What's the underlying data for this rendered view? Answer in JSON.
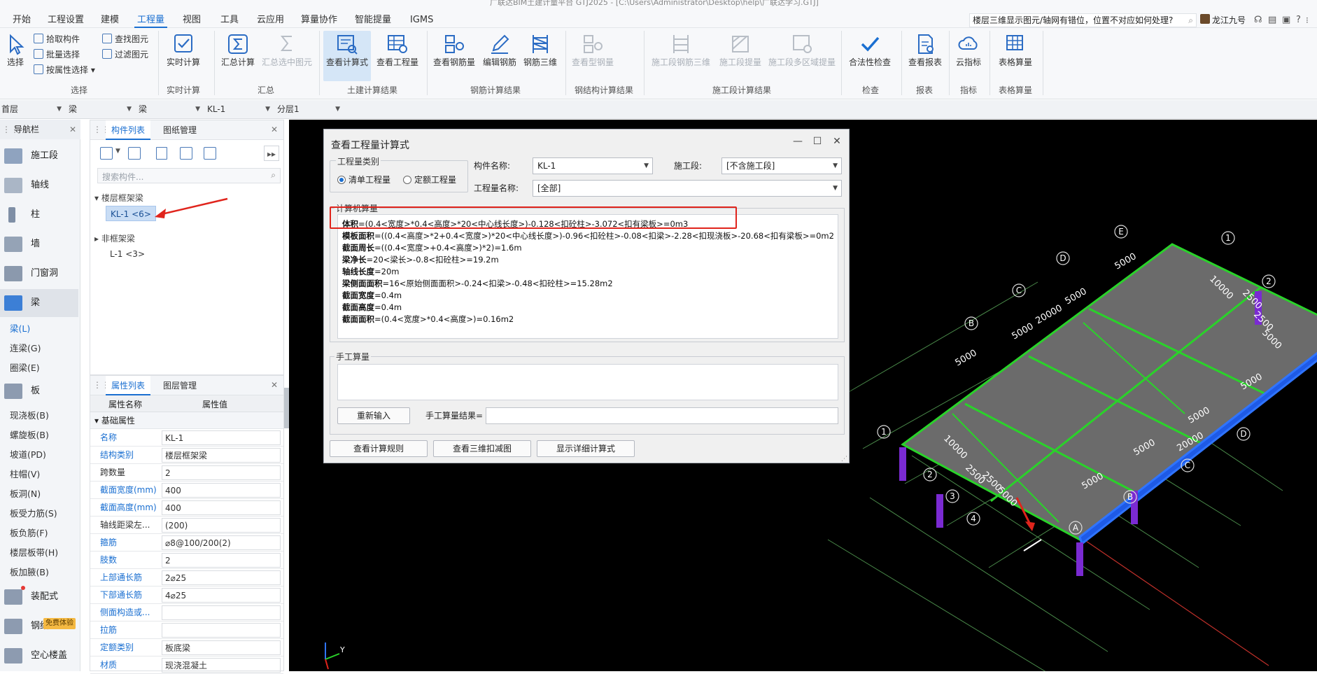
{
  "titlebar": {
    "left": "广联达BIM土建计量平台 GTJ2025 - [C:\\Users\\Administrator\\Desktop\\help\\广联达学习.GTJ]"
  },
  "menu": {
    "items": [
      "开始",
      "工程设置",
      "建模",
      "工程量",
      "视图",
      "工具",
      "云应用",
      "算量协作",
      "智能提量",
      "IGMS"
    ],
    "active_index": 3,
    "search_text": "楼层三维显示图元/轴网有错位，位置不对应如何处理?",
    "user": "龙江九号",
    "help": "?"
  },
  "ribbon": {
    "select": {
      "big": "选择",
      "s1": "拾取构件",
      "s2": "批量选择",
      "s3": "按属性选择",
      "s4": "查找图元",
      "s5": "过滤图元",
      "group": "选择"
    },
    "realtime": {
      "big": "实时计算",
      "group": "实时计算"
    },
    "summary": {
      "b1": "汇总计算",
      "b2": "汇总选中图元",
      "group": "汇总"
    },
    "civil": {
      "b1": "查看计算式",
      "b2": "查看工程量",
      "group": "土建计算结果"
    },
    "rebar": {
      "b1": "查看钢筋量",
      "b2": "编辑钢筋",
      "b3": "钢筋三维",
      "group": "钢筋计算结果"
    },
    "steel": {
      "b1": "查看型钢量",
      "group": "钢结构计算结果"
    },
    "stage": {
      "b1": "施工段钢筋三维",
      "b2": "施工段提量",
      "b3": "施工段多区域提量",
      "group": "施工段计算结果"
    },
    "check": {
      "b1": "合法性检查",
      "group": "检查"
    },
    "report": {
      "b1": "查看报表",
      "group": "报表"
    },
    "index": {
      "b1": "云指标",
      "group": "指标"
    },
    "table": {
      "b1": "表格算量",
      "group": "表格算量"
    }
  },
  "filterbar": {
    "floor": "首层",
    "type1": "梁",
    "type2": "梁",
    "comp": "KL-1",
    "layer": "分层1"
  },
  "nav": {
    "title": "导航栏",
    "items": [
      {
        "label": "施工段",
        "icon": "stage-icon"
      },
      {
        "label": "轴线",
        "icon": "axis-icon"
      },
      {
        "label": "柱",
        "icon": "column-icon"
      },
      {
        "label": "墙",
        "icon": "wall-icon"
      },
      {
        "label": "门窗洞",
        "icon": "door-window-icon"
      },
      {
        "label": "梁",
        "icon": "beam-icon"
      }
    ],
    "beam_subs": [
      "梁(L)",
      "连梁(G)",
      "圈梁(E)"
    ],
    "slab": "板",
    "slab_subs": [
      "现浇板(B)",
      "螺旋板(B)",
      "坡道(PD)",
      "柱帽(V)",
      "板洞(N)",
      "板受力筋(S)",
      "板负筋(F)",
      "楼层板带(H)",
      "板加腋(B)"
    ],
    "prefab": "装配式",
    "steel": "钢结构",
    "hollow": "空心楼盖",
    "trial_badge": "免费体验"
  },
  "complist": {
    "tabs": [
      "构件列表",
      "图纸管理"
    ],
    "search_placeholder": "搜索构件...",
    "groups": [
      {
        "name": "楼层框架梁",
        "items": [
          "KL-1 <6>"
        ]
      },
      {
        "name": "非框架梁",
        "items": [
          "L-1 <3>"
        ]
      }
    ]
  },
  "proplist": {
    "tabs": [
      "属性列表",
      "图层管理"
    ],
    "headers": [
      "属性名称",
      "属性值"
    ],
    "section": "基础属性",
    "rows": [
      {
        "k": "名称",
        "v": "KL-1",
        "blue": true
      },
      {
        "k": "结构类别",
        "v": "楼层框架梁",
        "blue": true
      },
      {
        "k": "跨数量",
        "v": "2",
        "blue": false
      },
      {
        "k": "截面宽度(mm)",
        "v": "400",
        "blue": true
      },
      {
        "k": "截面高度(mm)",
        "v": "400",
        "blue": true
      },
      {
        "k": "轴线距梁左...",
        "v": "(200)",
        "blue": false
      },
      {
        "k": "箍筋",
        "v": "⌀8@100/200(2)",
        "blue": true
      },
      {
        "k": "肢数",
        "v": "2",
        "blue": true
      },
      {
        "k": "上部通长筋",
        "v": "2⌀25",
        "blue": true
      },
      {
        "k": "下部通长筋",
        "v": "4⌀25",
        "blue": true
      },
      {
        "k": "侧面构造或...",
        "v": "",
        "blue": true
      },
      {
        "k": "拉筋",
        "v": "",
        "blue": true
      },
      {
        "k": "定额类别",
        "v": "板底梁",
        "blue": true
      },
      {
        "k": "材质",
        "v": "现浇混凝土",
        "blue": true
      }
    ]
  },
  "dialog": {
    "title": "查看工程量计算式",
    "qty_type_legend": "工程量类别",
    "radio1": "清单工程量",
    "radio2": "定额工程量",
    "comp_name_label": "构件名称:",
    "comp_name_value": "KL-1",
    "stage_label": "施工段:",
    "stage_value": "[不含施工段]",
    "qty_name_label": "工程量名称:",
    "qty_name_value": "[全部]",
    "calc_legend": "计算机算量",
    "formulas": [
      {
        "k": "体积",
        "v": "=(0.4<宽度>*0.4<高度>*20<中心线长度>)-0.128<扣砼柱>-3.072<扣有梁板>=0m3"
      },
      {
        "k": "模板面积",
        "v": "=((0.4<高度>*2+0.4<宽度>)*20<中心线长度>)-0.96<扣砼柱>-0.08<扣梁>-2.28<扣现浇板>-20.68<扣有梁板>=0m2"
      },
      {
        "k": "截面周长",
        "v": "=((0.4<宽度>+0.4<高度>)*2)=1.6m"
      },
      {
        "k": "梁净长",
        "v": "=20<梁长>-0.8<扣砼柱>=19.2m"
      },
      {
        "k": "轴线长度",
        "v": "=20m"
      },
      {
        "k": "梁侧面面积",
        "v": "=16<原始侧面面积>-0.24<扣梁>-0.48<扣砼柱>=15.28m2"
      },
      {
        "k": "截面宽度",
        "v": "=0.4m"
      },
      {
        "k": "截面高度",
        "v": "=0.4m"
      },
      {
        "k": "截面面积",
        "v": "=(0.4<宽度>*0.4<高度>)=0.16m2"
      }
    ],
    "manual_legend": "手工算量",
    "reinput": "重新输入",
    "manual_result_label": "手工算量结果=",
    "btn_rules": "查看计算规则",
    "btn_3d": "查看三维扣减图",
    "btn_detail": "显示详细计算式"
  },
  "viewport": {
    "axis_letters": [
      "A",
      "B",
      "C",
      "D",
      "E"
    ],
    "axis_numbers": [
      "1",
      "2",
      "3",
      "4"
    ],
    "dims": [
      "5000",
      "5000",
      "5000",
      "5000",
      "20000",
      "10000",
      "2500",
      "2500",
      "5000",
      "5000",
      "5000",
      "5000",
      "20000",
      "5000",
      "10000",
      "2500",
      "2500",
      "5000"
    ],
    "gizmo_y": "Y"
  }
}
